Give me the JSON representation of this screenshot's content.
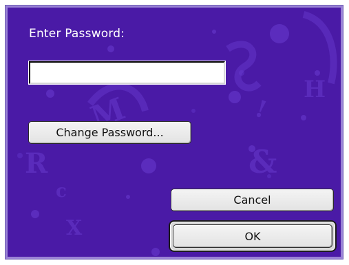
{
  "dialog": {
    "prompt_label": "Enter Password:",
    "password_value": "",
    "change_password_label": "Change Password...",
    "cancel_label": "Cancel",
    "ok_label": "OK"
  },
  "colors": {
    "background": "#4a1aa6",
    "border": "#9a83d6",
    "text": "#ffffff",
    "button_face": "#e8e8e8"
  },
  "icons": {
    "background_art": "decorative-letters-pattern"
  }
}
